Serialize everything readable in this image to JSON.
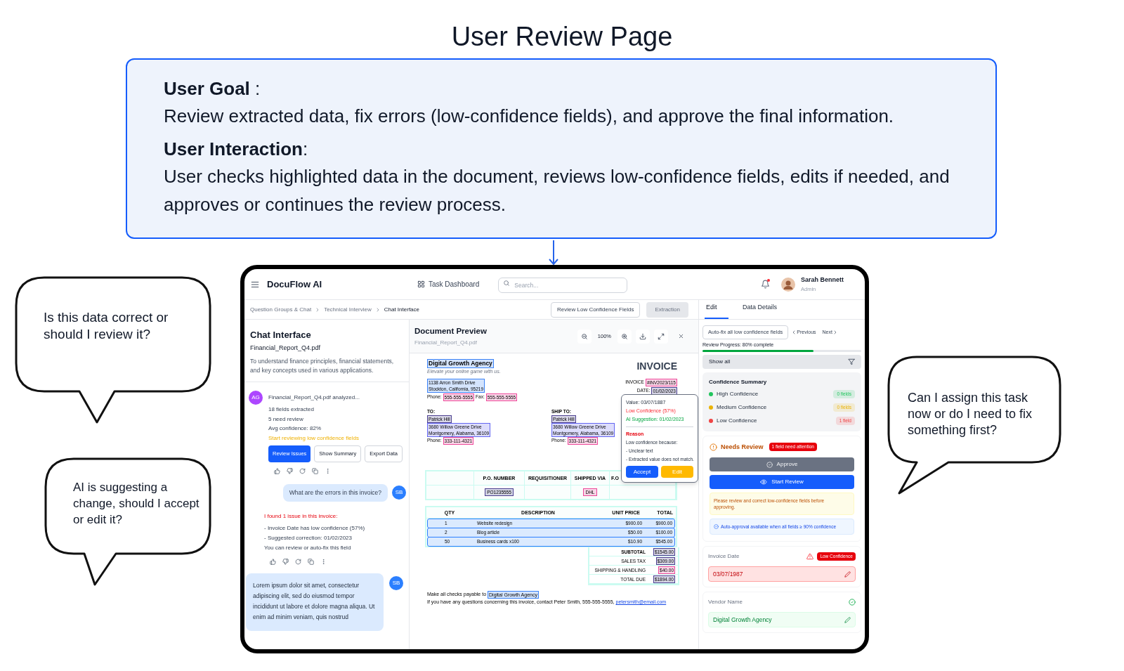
{
  "page_title": "User Review Page",
  "goal_box": [
    {
      "heading": "**User Goal** :",
      "text": "Review extracted data, fix errors (low-confidence fields), and approve the final information."
    },
    {
      "heading": "**User Interaction**:",
      "text": "User checks highlighted data in the document, reviews low-confidence fields, edits if needed, and approves or continues the review process."
    }
  ],
  "speech_bubbles": [
    {
      "text": "Is this data correct or should I review it?"
    },
    {
      "text": "AI is suggesting a change, should I accept or edit it?"
    },
    {
      "text": "Can I assign this task now or do I need to fix something first?"
    }
  ],
  "app": {
    "header": {
      "brand": "DocuFlow AI",
      "nav": "Task Dashboard",
      "search": {
        "placeholder": "Search..."
      },
      "unread": true,
      "user": {
        "name": "Sarah Bennett",
        "role": "Admin"
      }
    },
    "breadcrumbs": [
      {
        "label": "Question Groups & Chat",
        "current": false
      },
      {
        "label": "Technical Interview",
        "current": false
      },
      {
        "label": "Chat Interface",
        "current": true
      }
    ],
    "toolbar": [
      {
        "label": "Review Low Confidence Fields",
        "disabled": false
      },
      {
        "label": "Extraction",
        "disabled": true
      }
    ],
    "chat": {
      "title": "Chat Interface",
      "file": "Financial_Report_Q4.pdf",
      "description": "To understand finance principles, financial statements, and key concepts used in various applications.",
      "messages": [
        {
          "kind": "bot",
          "avatar": "AG",
          "title": "Financial_Report_Q4.pdf analyzed...",
          "lines": [
            {
              "text": "18 fields extracted",
              "kind": "plain"
            },
            {
              "text": "5 need review",
              "kind": "plain"
            },
            {
              "text": "Avg confidence: 82%",
              "kind": "plain"
            },
            {
              "text": "Start reviewing low confidence fields",
              "kind": "hint"
            }
          ],
          "buttons": [
            {
              "label": "Review Issues",
              "primary": true
            },
            {
              "label": "Show Summary",
              "primary": false
            },
            {
              "label": "Export Data",
              "primary": false
            }
          ],
          "actions": true
        },
        {
          "kind": "user",
          "avatar": "SB",
          "text": "What are the errors in this invoice?"
        },
        {
          "kind": "reply",
          "lines": [
            {
              "text": "I found 1 issue in this invoice:",
              "kind": "alert"
            },
            {
              "text": "- Invoice Date has low confidence (57%)",
              "kind": "plain"
            },
            {
              "text": "- Suggested correction: 01/02/2023",
              "kind": "plain"
            },
            {
              "text": "You can review or auto-fix this field",
              "kind": "plain"
            }
          ],
          "actions": true
        },
        {
          "kind": "note",
          "avatar": "SB",
          "text": "Lorem ipsum dolor sit amet, consectetur adipiscing elit, sed do eiusmod tempor incididunt ut labore et dolore magna aliqua. Ut enim ad minim veniam, quis nostrud"
        }
      ]
    },
    "preview": {
      "title": "Document Preview",
      "file": "Financial_Report_Q4.pdf",
      "zoom": "100%",
      "invoice": {
        "company": {
          "text": "Digital Growth Agency",
          "color": "#3b82f6"
        },
        "tagline": "Elevate your online game with us.",
        "address": {
          "lines": [
            "1138 Arron Smith Drive",
            "Stockton, California, 95219"
          ],
          "color": "#3b82f6"
        },
        "contact": [
          {
            "label": "Phone:",
            "value": "555-555-5555",
            "color": "#ec4899"
          },
          {
            "label": "Fax:",
            "value": "555-555-5555",
            "color": "#ec4899"
          }
        ],
        "title": "INVOICE",
        "meta": [
          {
            "label": "INVOICE",
            "value": "#INV2023/115",
            "color": "#ec4899"
          },
          {
            "label": "DATE:",
            "value": "01/02/2023",
            "color": "#4b3f8f"
          }
        ],
        "parties": [
          {
            "label": "TO:",
            "name": {
              "text": "Patrick Hill",
              "color": "#4b3f8f"
            },
            "address": {
              "lines": [
                "3680 Willow Greene Drive",
                "Montgomery, Alabama, 36109"
              ],
              "color": "#6366f1"
            },
            "phone": {
              "label": "Phone:",
              "value": "333-111-4321",
              "color": "#ec4899"
            }
          },
          {
            "label": "SHIP TO:",
            "name": {
              "text": "Patrick Hill",
              "color": "#4b3f8f"
            },
            "address": {
              "lines": [
                "3680 Willow Greene Drive",
                "Montgomery, Alabama, 36109"
              ],
              "color": "#6366f1"
            },
            "phone": {
              "label": "Phone:",
              "value": "333-111-4321",
              "color": "#ec4899"
            }
          }
        ],
        "order_table": {
          "columns": [
            {
              "label": "P.O. NUMBER",
              "value": {
                "text": "PO1235555",
                "color": "#4b3f8f"
              }
            },
            {
              "label": "REQUISITIONER"
            },
            {
              "label": "SHIPPED VIA",
              "value": {
                "text": "DHL",
                "color": "#ec4899"
              }
            },
            {
              "label": "F.O"
            }
          ]
        },
        "items": {
          "columns": [
            "QTY",
            "DESCRIPTION",
            "UNIT PRICE",
            "TOTAL"
          ],
          "rows": [
            [
              "1",
              "Website redesign",
              "$900.00",
              "$900.00"
            ],
            [
              "2",
              "Blog article",
              "$50.00",
              "$100.00"
            ],
            [
              "50",
              "Business cards x100",
              "$10.90",
              "$545.00"
            ]
          ]
        },
        "totals": [
          {
            "label": "SUBTOTAL",
            "value": "$1545.00",
            "color": "#4b3f8f",
            "bold": true
          },
          {
            "label": "SALES TAX",
            "value": "$309.00",
            "color": "#4b3f8f",
            "bold": false
          },
          {
            "label": "SHIPPING & HANDLING",
            "value": "$40.00",
            "color": "#ec4899",
            "bold": false
          },
          {
            "label": "TOTAL DUE",
            "value": "$1894.00",
            "color": "#4b3f8f",
            "bold": false
          }
        ],
        "footer": {
          "payable_text": "Make all checks payable to",
          "payable_to": {
            "text": "Digital Growth Agency",
            "color": "#3b82f6"
          },
          "contact_text": "If you have any questions concerning this invoice, contact Peter Smith, 555-555-5555,",
          "email": "petersmith@email.com"
        }
      },
      "popover": {
        "value": "Value: 03/07/1887",
        "confidence": "Low Confidence (57%)",
        "suggestion": "AI Suggestion: 01/02/2023",
        "reason_title": "Reason",
        "reason_lines": [
          "Low confidence because:",
          "- Unclear text",
          "- Extracted value does not match."
        ],
        "buttons": [
          {
            "label": "Accept",
            "kind": "primary"
          },
          {
            "label": "Edit",
            "kind": "warning"
          }
        ]
      }
    },
    "review": {
      "tabs": [
        {
          "label": "Edit",
          "selected": true
        },
        {
          "label": "Data Details",
          "selected": false
        }
      ],
      "autofix": "Auto-fix all low confidence fields",
      "prev": "Previous",
      "next": "Next",
      "progress": {
        "label": "Review Progress: 80% complete",
        "level": 0.7
      },
      "filter": "Show all",
      "summary": {
        "title": "Confidence Summary",
        "rows": [
          {
            "label": "High Confidence",
            "count": "0 fields",
            "color": "#22c55e"
          },
          {
            "label": "Medium Confidence",
            "count": "0 fields",
            "color": "#eab308"
          },
          {
            "label": "Low Confidence",
            "count": "1 field",
            "color": "#ef4444"
          }
        ]
      },
      "status": {
        "title": "Needs Review",
        "badge": "1 field need attention",
        "approve": {
          "label": "Approve",
          "disabled": true
        },
        "start": "Start Review",
        "warning": "Please review and correct low-confidence fields before approving.",
        "info": "Auto-approval available when all fields ≥ 90% confidence"
      },
      "fields": [
        {
          "label": "Invoice Date",
          "value": "03/07/1987",
          "kind": "low",
          "badge": "Low Confidence"
        },
        {
          "label": "Vendor Name",
          "value": "Digital Growth Agency",
          "kind": "ok"
        }
      ]
    }
  }
}
